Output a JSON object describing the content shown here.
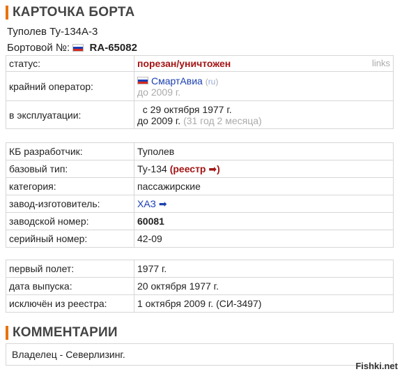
{
  "card": {
    "title": "КАРТОЧКА БОРТА",
    "aircraft_name": "Туполев Ту-134А-3",
    "board_label": "Бортовой №:",
    "board_number": "RA-65082",
    "flag_icon": "russia-flag-icon"
  },
  "status_table": {
    "rows": [
      {
        "key": "статус:",
        "value": "порезан/уничтожен",
        "extra": "links"
      },
      {
        "key": "крайний оператор:",
        "operator": "СмартАвиа",
        "operator_tag": "ru",
        "operator_since": "до 2009 г."
      },
      {
        "key": "в эксплуатации:",
        "value_line1": "с 29 октября 1977 г.",
        "value_line2": "до 2009 г.",
        "duration": "(31 год 2 месяца)"
      }
    ]
  },
  "spec_table": {
    "rows": [
      {
        "key": "КБ разработчик:",
        "value": "Туполев"
      },
      {
        "key": "базовый тип:",
        "value": "Ту-134",
        "link": "(реестр ➡)"
      },
      {
        "key": "категория:",
        "value": "пассажирские"
      },
      {
        "key": "завод-изготовитель:",
        "value": "ХАЗ ➡"
      },
      {
        "key": "заводской номер:",
        "value": "60081"
      },
      {
        "key": "серийный номер:",
        "value": "42-09"
      }
    ]
  },
  "dates_table": {
    "rows": [
      {
        "key": "первый полет:",
        "value": "1977 г."
      },
      {
        "key": "дата выпуска:",
        "value": "20 октября 1977 г."
      },
      {
        "key": "исключён из реестра:",
        "value": "1 октября 2009 г. (СИ-3497)"
      }
    ]
  },
  "comments": {
    "title": "КОММЕНТАРИИ",
    "text": "Владелец - Северлизинг."
  },
  "watermark": "Fishki.net",
  "colors": {
    "accent": "#e8730c",
    "status_danger": "#a31515",
    "link_blue": "#1a3fb0",
    "muted": "#aaaaaa"
  }
}
